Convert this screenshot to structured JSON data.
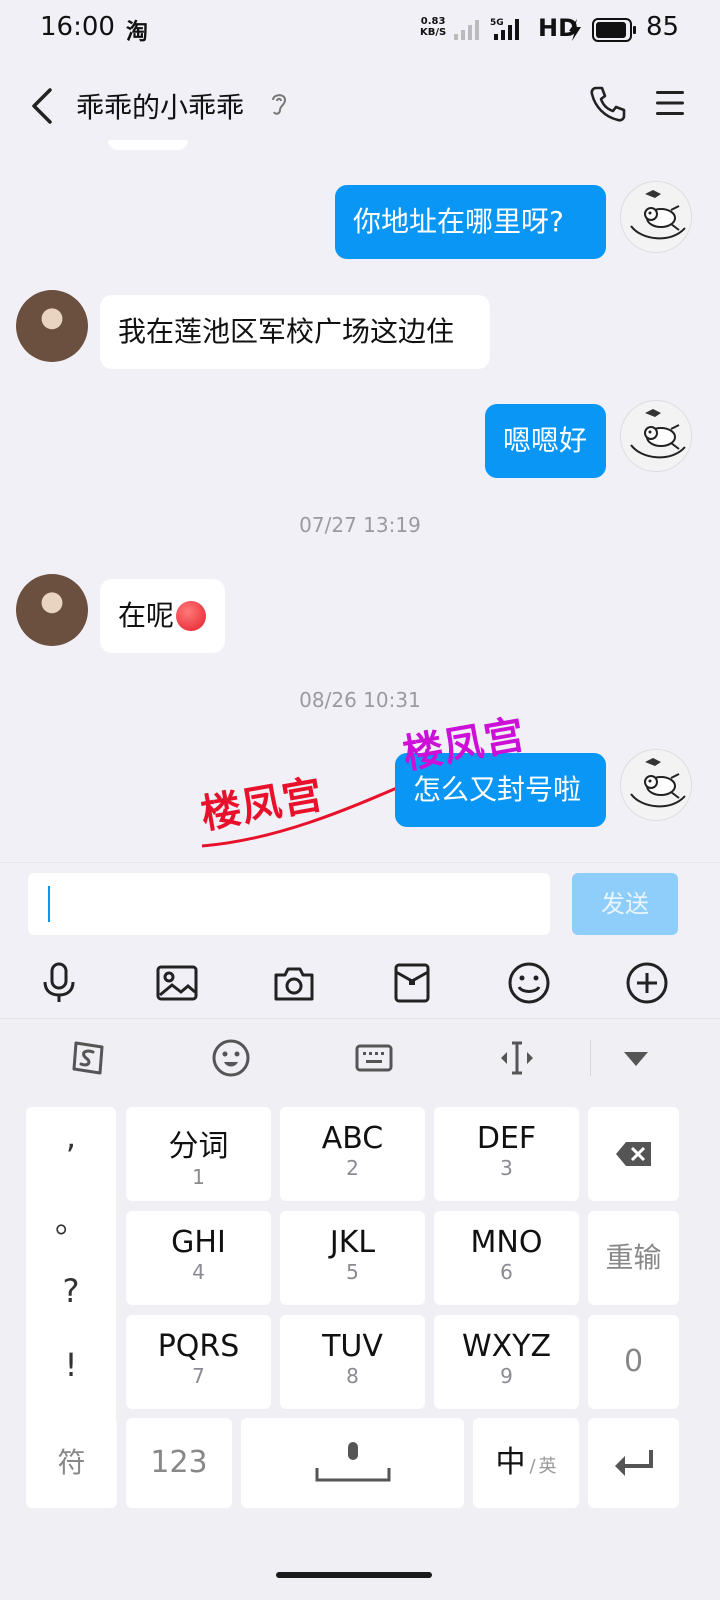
{
  "status_bar": {
    "time": "16:00",
    "app_indicator": "淘",
    "net_speed_value": "0.83",
    "net_speed_unit": "KB/S",
    "network": "HD",
    "battery": "85"
  },
  "header": {
    "title": "乖乖的小乖乖",
    "icons": [
      "back-icon",
      "ear-icon",
      "phone-icon",
      "menu-icon"
    ]
  },
  "messages": [
    {
      "from": "me",
      "text": "你地址在哪里呀?"
    },
    {
      "from": "other",
      "text": "我在莲池区军校广场这边住"
    },
    {
      "from": "me",
      "text": "嗯嗯好"
    },
    {
      "timestamp": "07/27 13:19"
    },
    {
      "from": "other",
      "text": "在呢"
    },
    {
      "timestamp": "08/26 10:31"
    },
    {
      "from": "me",
      "text": "怎么又封号啦"
    }
  ],
  "watermark": {
    "text_left": "楼凤宫",
    "text_right": "楼凤宫",
    "colors": [
      "#e8102a",
      "#cc10d8"
    ]
  },
  "input": {
    "value": "",
    "send_label": "发送"
  },
  "toolbar_icons": [
    "microphone-icon",
    "image-icon",
    "camera-icon",
    "red-packet-icon",
    "emoji-icon",
    "plus-icon"
  ],
  "keyboard": {
    "toolbar_icons": [
      "sogou-logo-icon",
      "emoji-icon",
      "keyboard-icon",
      "cursor-move-icon",
      "collapse-icon"
    ],
    "punctuation": [
      ",",
      "。",
      "?",
      "!"
    ],
    "keys": [
      {
        "main": "分词",
        "sub": "1"
      },
      {
        "main": "ABC",
        "sub": "2"
      },
      {
        "main": "DEF",
        "sub": "3"
      },
      {
        "main": "GHI",
        "sub": "4"
      },
      {
        "main": "JKL",
        "sub": "5"
      },
      {
        "main": "MNO",
        "sub": "6"
      },
      {
        "main": "PQRS",
        "sub": "7"
      },
      {
        "main": "TUV",
        "sub": "8"
      },
      {
        "main": "WXYZ",
        "sub": "9"
      }
    ],
    "reset_label": "重输",
    "zero_label": "0",
    "symbol_label": "符",
    "num_label": "123",
    "lang_main": "中",
    "lang_sep": "/",
    "lang_alt": "英"
  },
  "colors": {
    "accent": "#0a96f5",
    "send_disabled": "#8fcdfa",
    "background": "#f0f0f6"
  }
}
